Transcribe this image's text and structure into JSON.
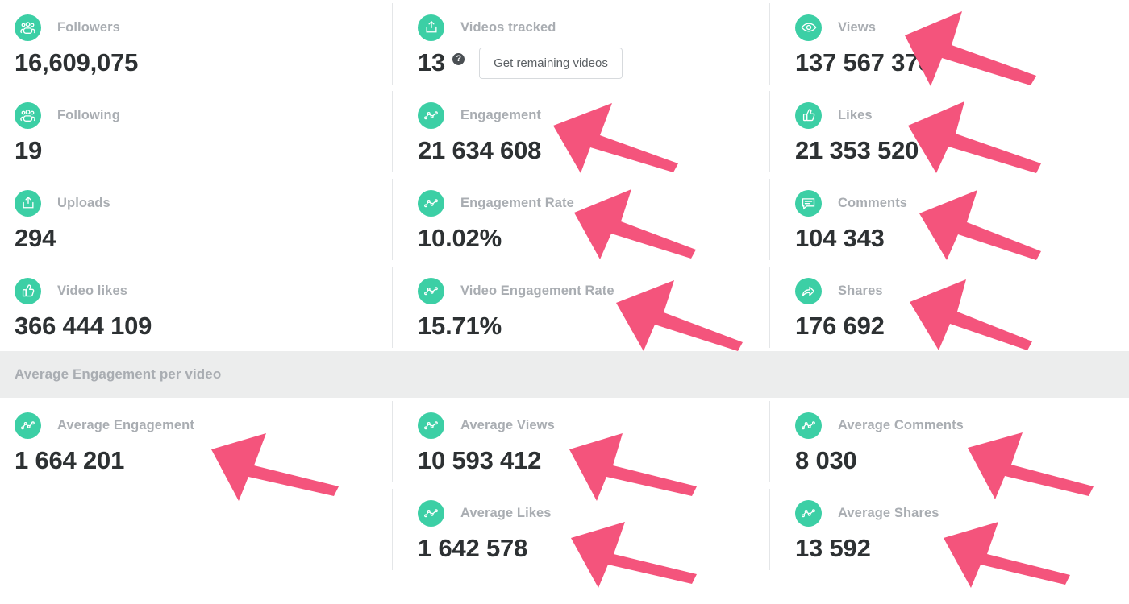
{
  "theme": {
    "accent": "#3ccfa5",
    "value_color": "#2d3133",
    "label_color": "#a9adb2",
    "band_bg": "#eceded",
    "arrow_color": "#f4547c",
    "divider": "#e4e6e8"
  },
  "main_metrics": {
    "left_column": [
      {
        "icon": "followers-icon",
        "label": "Followers",
        "value": "16,609,075"
      },
      {
        "icon": "following-icon",
        "label": "Following",
        "value": "19"
      },
      {
        "icon": "uploads-icon",
        "label": "Uploads",
        "value": "294"
      },
      {
        "icon": "thumbs-up-icon",
        "label": "Video likes",
        "value": "366 444 109"
      }
    ],
    "middle_column": [
      {
        "icon": "uploads-icon",
        "label": "Videos tracked",
        "value": "13",
        "help_glyph": "?",
        "button_label": "Get remaining videos"
      },
      {
        "icon": "graph-icon",
        "label": "Engagement",
        "value": "21 634 608"
      },
      {
        "icon": "graph-icon",
        "label": "Engagement Rate",
        "value": "10.02%"
      },
      {
        "icon": "graph-icon",
        "label": "Video Engagement Rate",
        "value": "15.71%"
      }
    ],
    "right_column": [
      {
        "icon": "eye-icon",
        "label": "Views",
        "value": "137 567 378"
      },
      {
        "icon": "thumbs-up-icon",
        "label": "Likes",
        "value": "21 353 520"
      },
      {
        "icon": "comment-icon",
        "label": "Comments",
        "value": "104 343"
      },
      {
        "icon": "share-icon",
        "label": "Shares",
        "value": "176 692"
      }
    ]
  },
  "section": {
    "title": "Average Engagement per video"
  },
  "average_metrics": {
    "left_column": [
      {
        "icon": "graph-icon",
        "label": "Average Engagement",
        "value": "1 664 201"
      }
    ],
    "middle_column": [
      {
        "icon": "graph-icon",
        "label": "Average Views",
        "value": "10 593 412"
      },
      {
        "icon": "graph-icon",
        "label": "Average Likes",
        "value": "1 642 578"
      }
    ],
    "right_column": [
      {
        "icon": "graph-icon",
        "label": "Average Comments",
        "value": "8 030"
      },
      {
        "icon": "graph-icon",
        "label": "Average Shares",
        "value": "13 592"
      }
    ]
  },
  "annotations": {
    "arrow_count": 12,
    "description": "pink annotation arrows pointing up-left at metric values"
  }
}
